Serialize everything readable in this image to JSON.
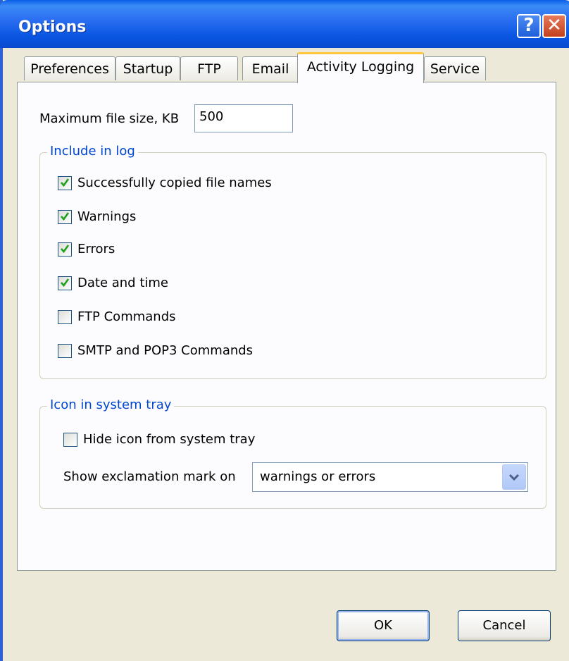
{
  "window": {
    "title": "Options",
    "help_glyph": "?",
    "close_glyph": "✕"
  },
  "tabs": [
    {
      "label": "Preferences",
      "active": false
    },
    {
      "label": "Startup",
      "active": false
    },
    {
      "label": "FTP",
      "active": false
    },
    {
      "label": "Email",
      "active": false
    },
    {
      "label": "Activity Logging",
      "active": true
    },
    {
      "label": "Service",
      "active": false
    }
  ],
  "log": {
    "max_size_label": "Maximum file size, KB",
    "max_size_value": "500",
    "include_group_title": "Include in log",
    "options": [
      {
        "label": "Successfully copied file names",
        "checked": true
      },
      {
        "label": "Warnings",
        "checked": true
      },
      {
        "label": "Errors",
        "checked": true
      },
      {
        "label": "Date and time",
        "checked": true
      },
      {
        "label": "FTP Commands",
        "checked": false
      },
      {
        "label": "SMTP and POP3 Commands",
        "checked": false
      }
    ]
  },
  "tray": {
    "group_title": "Icon in system tray",
    "hide_icon_label": "Hide icon from system tray",
    "hide_icon_checked": false,
    "exclamation_label": "Show exclamation mark on",
    "exclamation_value": "warnings or errors"
  },
  "buttons": {
    "ok": "OK",
    "cancel": "Cancel"
  },
  "colors": {
    "title_bar": "#0a5ee8",
    "group_title": "#0046d5",
    "check": "#21a121",
    "active_tab_accent": "#ffc83c"
  }
}
